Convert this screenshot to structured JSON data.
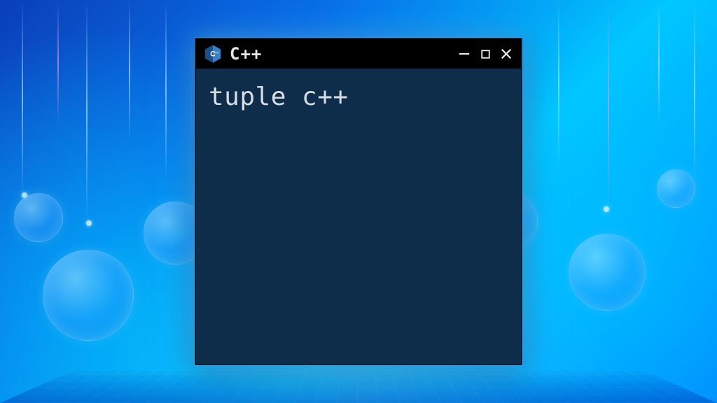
{
  "window": {
    "title": "C++",
    "icon_name": "cpp-hexagon-icon"
  },
  "terminal": {
    "content": "tuple c++"
  },
  "colors": {
    "terminal_bg": "#0d2d4a",
    "titlebar_bg": "#000000",
    "text": "#d8dde3",
    "icon_primary": "#1b4f8a",
    "icon_secondary": "#3d7fc4"
  }
}
